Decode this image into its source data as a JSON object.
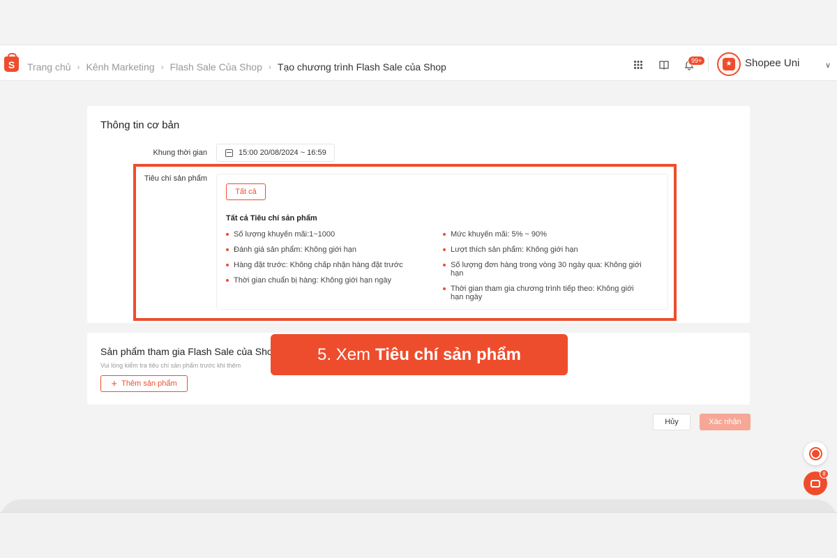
{
  "breadcrumb": {
    "items": [
      "Trang chủ",
      "Kênh Marketing",
      "Flash Sale Của Shop"
    ],
    "current": "Tạo chương trình Flash Sale của Shop"
  },
  "header": {
    "logo_letter": "S",
    "notification_badge": "99+",
    "user_name": "Shopee Uni"
  },
  "basic_info": {
    "title": "Thông tin cơ bản",
    "time_label": "Khung thời gian",
    "time_value": "15:00 20/08/2024 ~ 16:59",
    "criteria_label": "Tiêu chí sản phẩm",
    "tab_all": "Tất cả",
    "criteria_heading": "Tất cả Tiêu chí sản phẩm",
    "criteria_left": [
      "Số lượng khuyến mãi:1~1000",
      "Đánh giá sản phẩm: Không giới hạn",
      "Hàng đặt trước: Không chấp nhận hàng đặt trước",
      "Thời gian chuẩn bị hàng: Không giới hạn ngày"
    ],
    "criteria_right": [
      "Mức khuyến mãi: 5% ~ 90%",
      "Lượt thích sản phẩm: Không giới hạn",
      "Số lượng đơn hàng trong vòng 30 ngày qua: Không giới hạn",
      "Thời gian tham gia chương trình tiếp theo: Không giới hạn ngày"
    ]
  },
  "products": {
    "title": "Sản phẩm tham gia Flash Sale của Sho",
    "hint": "Vui lòng kiểm tra tiêu chí sản phẩm trước khi thêm",
    "add_button": "Thêm sản phẩm"
  },
  "banner": {
    "prefix": "5. Xem",
    "emphasis": "Tiêu chí sản phẩm"
  },
  "actions": {
    "cancel": "Hủy",
    "confirm": "Xác nhận"
  },
  "chat_badge": "8",
  "colors": {
    "accent": "#ee4d2d",
    "confirm_disabled": "#f6a796"
  }
}
